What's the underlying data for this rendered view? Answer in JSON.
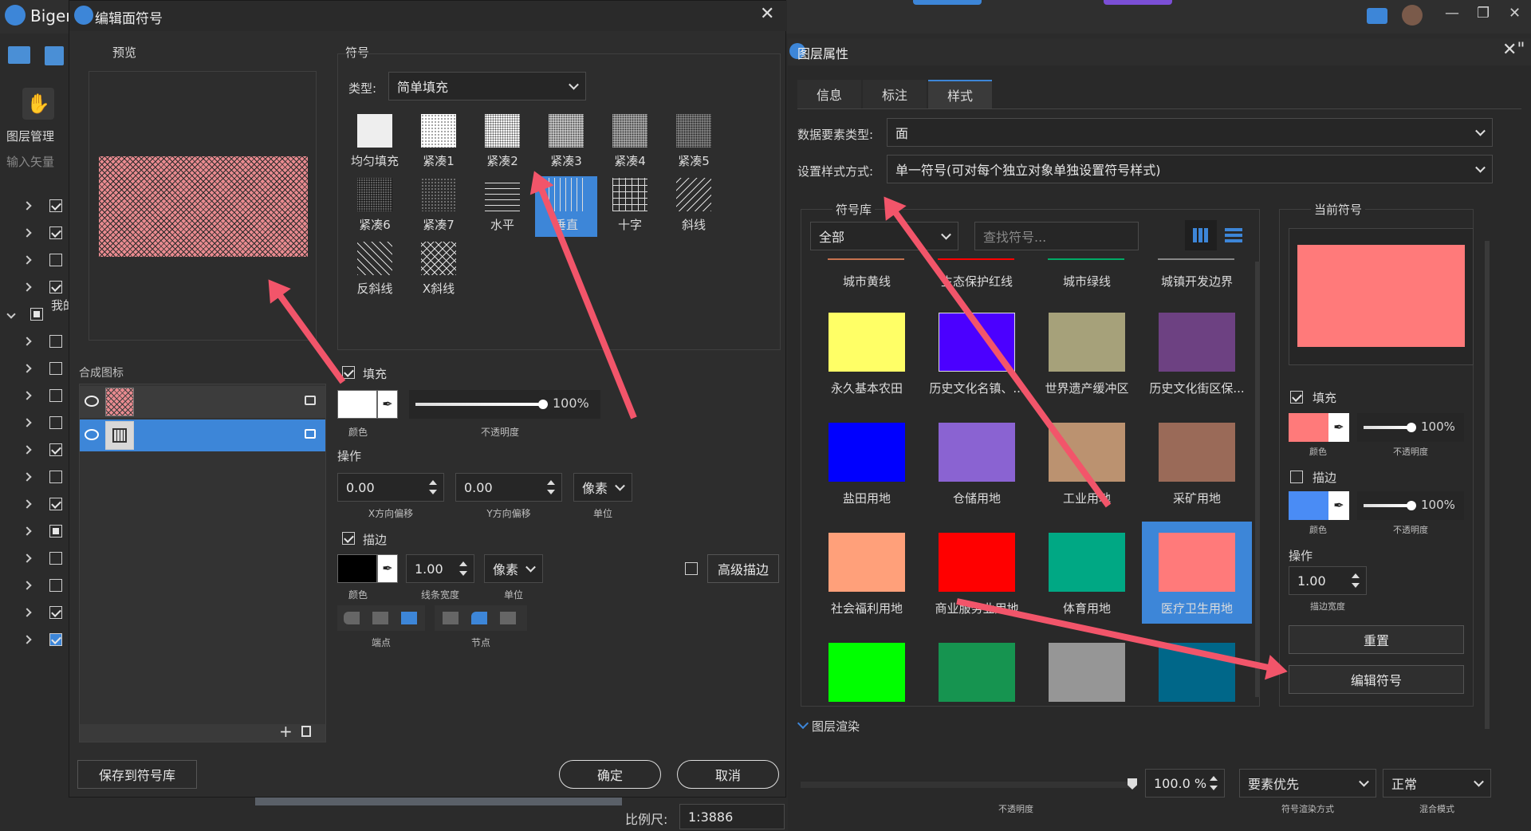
{
  "app": {
    "title": "Bigen"
  },
  "window_controls": {
    "min": "—",
    "max": "❐",
    "close": "✕"
  },
  "left_panel": {
    "layer_mgmt": "图层管理",
    "search_placeholder": "输入矢量",
    "group_label": "我的"
  },
  "dialog": {
    "title": "编辑面符号",
    "preview_label": "预览",
    "symbol_label": "符号",
    "type_label": "类型:",
    "type_value": "简单填充",
    "patterns": [
      "均匀填充",
      "紧凑1",
      "紧凑2",
      "紧凑3",
      "紧凑4",
      "紧凑5",
      "紧凑6",
      "紧凑7",
      "水平",
      "垂直",
      "十字",
      "斜线",
      "反斜线",
      "X斜线"
    ],
    "composite_label": "合成图标",
    "fill": {
      "label": "填充",
      "opacity": "100%",
      "color_caption": "颜色",
      "opacity_caption": "不透明度",
      "checked": true
    },
    "operation": {
      "label": "操作",
      "x_offset": "0.00",
      "y_offset": "0.00",
      "unit": "像素",
      "x_caption": "X方向偏移",
      "y_caption": "Y方向偏移",
      "unit_caption": "单位"
    },
    "stroke": {
      "label": "描边",
      "width": "1.00",
      "unit": "像素",
      "color_caption": "颜色",
      "width_caption": "线条宽度",
      "unit_caption": "单位",
      "advanced": "高级描边",
      "endpoint_caption": "端点",
      "joint_caption": "节点",
      "checked": true
    },
    "save_to_lib": "保存到符号库",
    "ok": "确定",
    "cancel": "取消"
  },
  "props": {
    "title": "图层属性",
    "tabs": [
      "信息",
      "标注",
      "样式"
    ],
    "feature_type_label": "数据要素类型:",
    "feature_type_value": "面",
    "style_mode_label": "设置样式方式:",
    "style_mode_value": "单一符号(可对每个独立对象单独设置符号样式)",
    "library_label": "符号库",
    "library_filter": "全部",
    "search_placeholder": "查找符号...",
    "top_labels": [
      "城市黄线",
      "生态保护红线",
      "城市绿线",
      "城镇开发边界"
    ],
    "symbols": [
      {
        "name": "永久基本农田",
        "color": "#ffff66"
      },
      {
        "name": "历史文化名镇、...",
        "color": "#4b00ff"
      },
      {
        "name": "世界遗产缓冲区",
        "color": "#a6a17a"
      },
      {
        "name": "历史文化街区保...",
        "color": "#6d4182"
      },
      {
        "name": "盐田用地",
        "color": "#0000ff"
      },
      {
        "name": "仓储用地",
        "color": "#8a63d2"
      },
      {
        "name": "工业用地",
        "color": "#bb9270"
      },
      {
        "name": "采矿用地",
        "color": "#9a6a58"
      },
      {
        "name": "社会福利用地",
        "color": "#ffa07a"
      },
      {
        "name": "商业服务业用地",
        "color": "#ff0000"
      },
      {
        "name": "体育用地",
        "color": "#00a884"
      },
      {
        "name": "医疗卫生用地",
        "color": "#ff7a7a"
      },
      {
        "name": "",
        "color": "#00ff00"
      },
      {
        "name": "",
        "color": "#169450"
      },
      {
        "name": "",
        "color": "#969696"
      },
      {
        "name": "",
        "color": "#006789"
      }
    ],
    "current_label": "当前符号",
    "current_color": "#ff7a7a",
    "fill_label": "填充",
    "fill_opacity": "100%",
    "color_caption": "颜色",
    "opacity_caption": "不透明度",
    "stroke_label": "描边",
    "stroke_opacity": "100%",
    "operation_label": "操作",
    "stroke_width": "1.00",
    "stroke_width_caption": "描边宽度",
    "reset": "重置",
    "edit_symbol": "编辑符号",
    "render_label": "图层渲染",
    "render_opacity": "100.0 %",
    "render_mode": "要素优先",
    "blend": "正常",
    "render_opacity_caption": "不透明度",
    "render_mode_caption": "符号渲染方式",
    "blend_caption": "混合模式"
  },
  "status": {
    "scale_label": "比例尺:",
    "scale_value": "1:3886"
  }
}
